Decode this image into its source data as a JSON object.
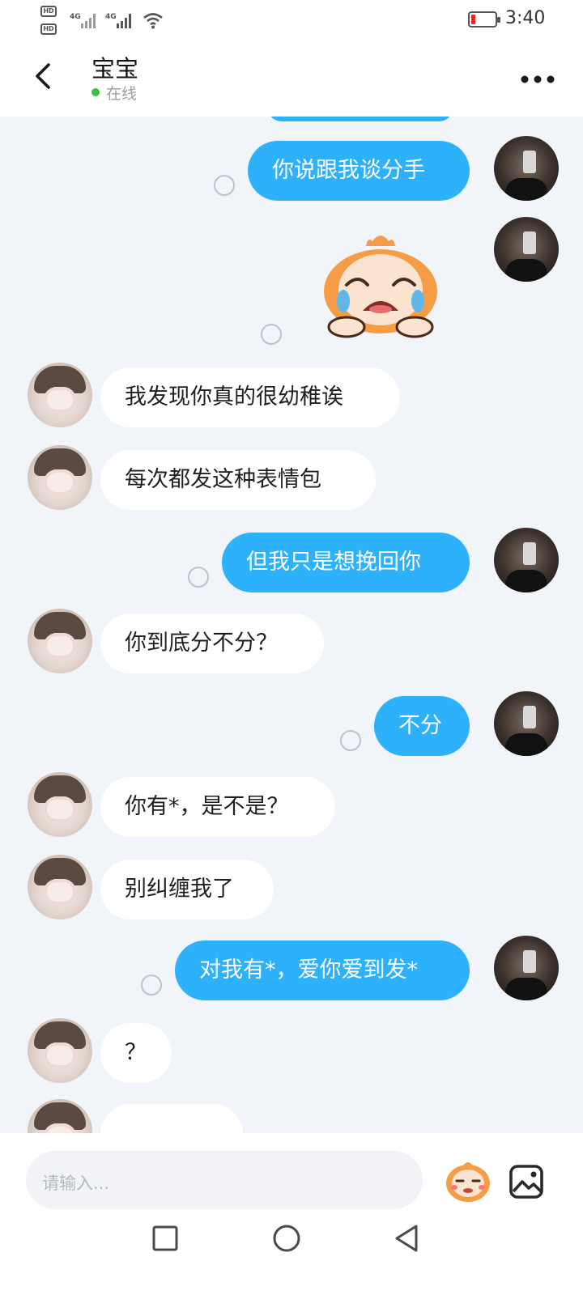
{
  "status_bar": {
    "hd_1": "HD",
    "hd_2": "HD",
    "net_1": "4G",
    "net_2": "4G",
    "time": "3:40"
  },
  "header": {
    "title": "宝宝",
    "status": "在线",
    "status_color": "#37c33f"
  },
  "messages": [
    {
      "side": "me",
      "text": "你说跟我谈分手"
    },
    {
      "side": "me",
      "type": "sticker",
      "sticker": "crying-cartoon-sticker"
    },
    {
      "side": "her",
      "text": "我发现你真的很幼稚诶"
    },
    {
      "side": "her",
      "text": "每次都发这种表情包"
    },
    {
      "side": "me",
      "text": "但我只是想挽回你"
    },
    {
      "side": "her",
      "text": "你到底分不分？"
    },
    {
      "side": "me",
      "text": "不分"
    },
    {
      "side": "her",
      "text": "你有*，是不是？"
    },
    {
      "side": "her",
      "text": "别纠缠我了"
    },
    {
      "side": "me",
      "text": "对我有*，爱你爱到发*"
    },
    {
      "side": "her",
      "text": "？"
    }
  ],
  "input": {
    "placeholder": "请输入..."
  },
  "colors": {
    "my_bubble": "#2db1fb",
    "her_bubble": "#ffffff",
    "background": "#f1f4f9"
  },
  "icons": {
    "back": "chevron-left-icon",
    "more": "more-dots-icon",
    "emoji": "emoji-icon",
    "image": "image-icon",
    "nav_square": "recents-icon",
    "nav_circle": "home-icon",
    "nav_triangle": "back-triangle-icon"
  }
}
